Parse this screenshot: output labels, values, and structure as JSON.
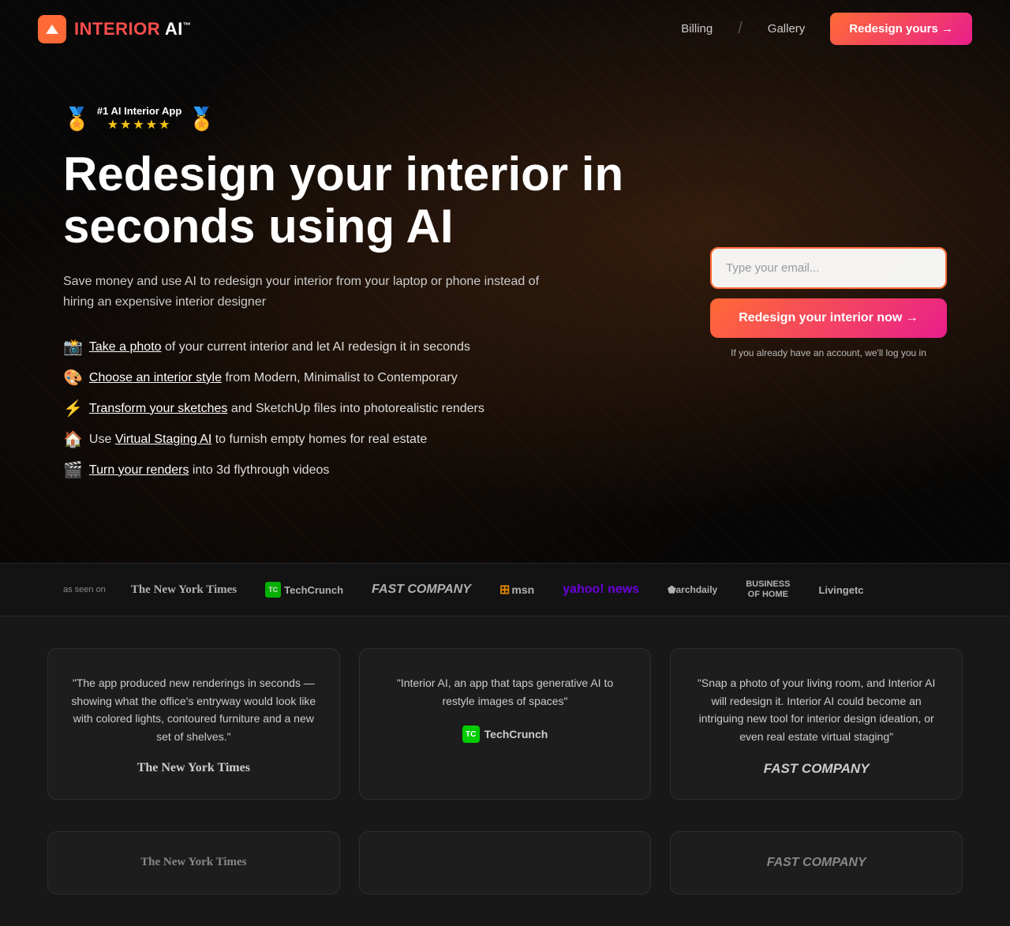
{
  "navbar": {
    "logo_text": "INTERIOR AI",
    "logo_tm": "™",
    "billing_label": "Billing",
    "gallery_label": "Gallery",
    "cta_label": "Redesign yours →"
  },
  "hero": {
    "badge": {
      "rank": "#1 AI Interior App",
      "stars": "★★★★★"
    },
    "title_line1": "Redesign your interior in",
    "title_line2": "seconds using AI",
    "subtitle": "Save money and use AI to redesign your interior from your laptop or phone instead of hiring an expensive interior designer",
    "features": [
      {
        "emoji": "📸",
        "link_text": "Take a photo",
        "rest_text": " of your current interior and let AI redesign it in seconds"
      },
      {
        "emoji": "🎨",
        "link_text": "Choose an interior style",
        "rest_text": " from Modern, Minimalist to Contemporary"
      },
      {
        "emoji": "⚡",
        "link_text": "Transform your sketches",
        "rest_text": " and SketchUp files into photorealistic renders"
      },
      {
        "emoji": "🏠",
        "link_text_pre": "Use ",
        "link_text": "Virtual Staging AI",
        "rest_text": " to furnish empty homes for real estate"
      },
      {
        "emoji": "🎬",
        "link_text": "Turn your renders",
        "rest_text": " into 3d flythrough videos"
      }
    ],
    "email_placeholder": "Type your email...",
    "redesign_cta": "Redesign your interior now →",
    "login_note": "If you already have an account, we'll log you in"
  },
  "press": {
    "as_seen_on": "as seen on",
    "logos": [
      "The New York Times",
      "TechCrunch",
      "FAST COMPANY",
      "msn",
      "yahoo! news",
      "archdaily",
      "BUSINESS OF HOME",
      "Livingetc"
    ]
  },
  "testimonials": [
    {
      "quote": "\"The app produced new renderings in seconds — showing what the office's entryway would look like with colored lights, contoured furniture and a new set of shelves.\"",
      "logo_type": "nyt",
      "logo_text": "The New York Times"
    },
    {
      "quote": "\"Interior AI, an app that taps generative AI to restyle images of spaces\"",
      "logo_type": "tc",
      "logo_text": "TechCrunch"
    },
    {
      "quote": "\"Snap a photo of your living room, and Interior AI will redesign it. Interior AI could become an intriguing new tool for interior design ideation, or even real estate virtual staging\"",
      "logo_type": "fastco",
      "logo_text": "FAST COMPANY"
    }
  ],
  "bottom_logos": [
    {
      "type": "nyt",
      "text": "The New York Times"
    },
    {
      "type": "fastco",
      "text": "FAST COMPANY"
    }
  ]
}
